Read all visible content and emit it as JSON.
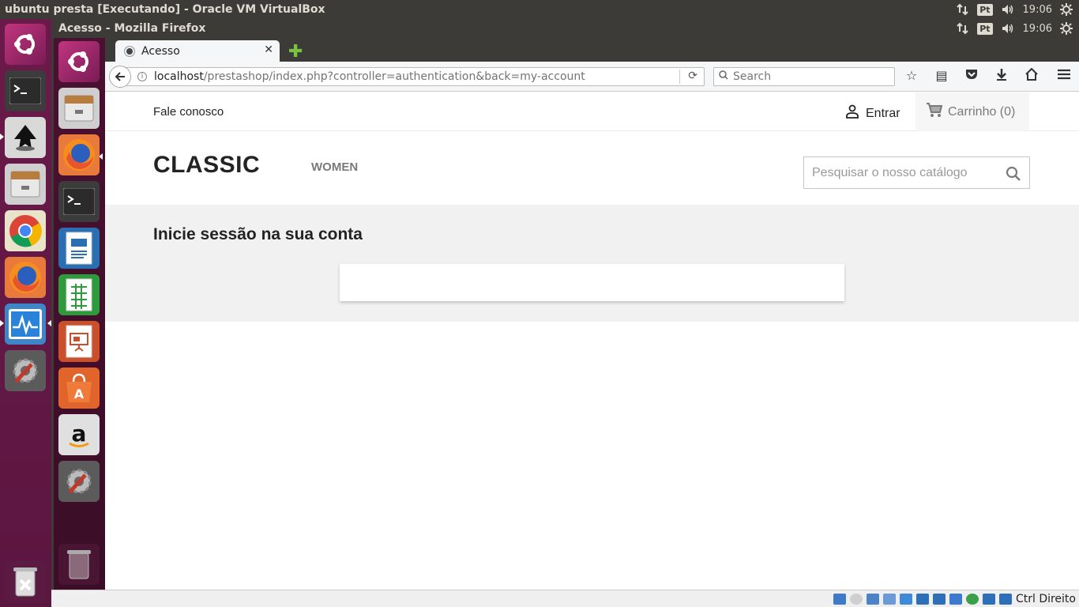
{
  "host": {
    "window_title": "ubuntu presta [Executando] - Oracle VM VirtualBox",
    "tray": {
      "keyboard": "Pt",
      "time": "19:06"
    }
  },
  "guest": {
    "window_title": "Acesso - Mozilla Firefox",
    "tray": {
      "keyboard": "Pt",
      "time": "19:06"
    }
  },
  "host_launcher_items": [
    "ubuntu-dash-icon",
    "terminal-icon",
    "inkscape-icon",
    "files-icon",
    "chrome-icon",
    "firefox-icon",
    "system-monitor-icon",
    "system-settings-icon",
    "trash-icon"
  ],
  "guest_launcher_items": [
    "ubuntu-dash-icon",
    "files-icon",
    "firefox-icon",
    "terminal-icon",
    "writer-icon",
    "calc-icon",
    "impress-icon",
    "software-center-icon",
    "amazon-icon",
    "system-settings-icon",
    "trash-icon"
  ],
  "browser": {
    "tab_title": "Acesso",
    "url_host": "localhost",
    "url_path": "/prestashop/index.php?controller=authentication&back=my-account",
    "search_placeholder": "Search"
  },
  "shop": {
    "contact_link": "Fale conosco",
    "sign_in": "Entrar",
    "cart": "Carrinho (0)",
    "logo": "CLASSIC",
    "menu": [
      "WOMEN"
    ],
    "search_placeholder": "Pesquisar o nosso catálogo",
    "page_title": "Inicie sessão na sua conta"
  },
  "vbox_status": {
    "host_key": "Ctrl Direito"
  }
}
